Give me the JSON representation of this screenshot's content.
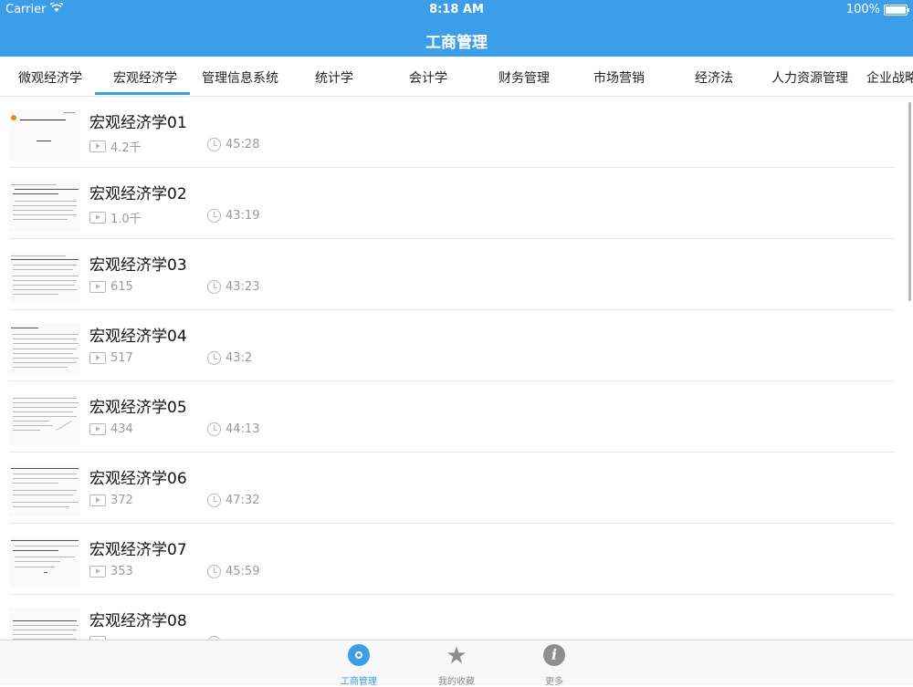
{
  "status_bar": {
    "carrier": "Carrier",
    "time": "8:18 AM",
    "battery": "100%"
  },
  "nav": {
    "title": "工商管理"
  },
  "tabs": [
    "微观经济学",
    "宏观经济学",
    "管理信息系统",
    "统计学",
    "会计学",
    "财务管理",
    "市场营销",
    "经济法",
    "人力资源管理",
    "企业战略"
  ],
  "selected_tab": "宏观经济学",
  "items": [
    {
      "title": "宏观经济学01",
      "views": "4.2千",
      "duration": "45:28"
    },
    {
      "title": "宏观经济学02",
      "views": "1.0千",
      "duration": "43:19"
    },
    {
      "title": "宏观经济学03",
      "views": "615",
      "duration": "43:23"
    },
    {
      "title": "宏观经济学04",
      "views": "517",
      "duration": "43:2"
    },
    {
      "title": "宏观经济学05",
      "views": "434",
      "duration": "44:13"
    },
    {
      "title": "宏观经济学06",
      "views": "372",
      "duration": "47:32"
    },
    {
      "title": "宏观经济学07",
      "views": "353",
      "duration": "45:59"
    },
    {
      "title": "宏观经济学08",
      "views": "",
      "duration": ""
    }
  ],
  "tabbar": [
    {
      "label": "工商管理",
      "icon": "disc-icon",
      "active": true
    },
    {
      "label": "我的收藏",
      "icon": "star-icon",
      "active": false
    },
    {
      "label": "更多",
      "icon": "info-icon",
      "active": false
    }
  ],
  "colors": {
    "accent": "#3d9ee8"
  }
}
